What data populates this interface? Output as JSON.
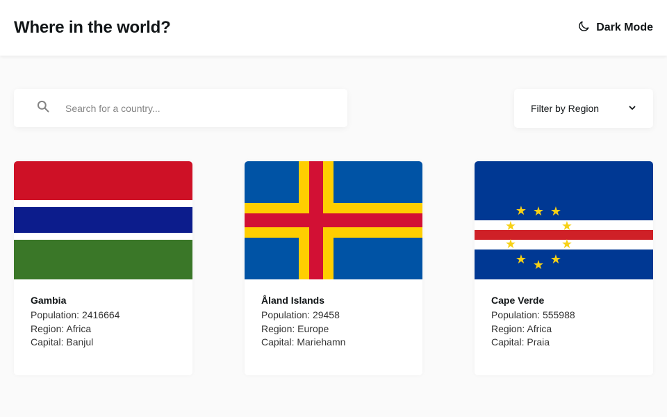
{
  "header": {
    "title": "Where in the world?",
    "theme_toggle_label": "Dark Mode",
    "theme_toggle_icon": "moon-icon"
  },
  "search": {
    "placeholder": "Search for a country...",
    "value": "",
    "icon": "search-icon"
  },
  "filter": {
    "label": "Filter by Region",
    "icon": "chevron-down-icon"
  },
  "labels": {
    "population": "Population:",
    "region": "Region:",
    "capital": "Capital:"
  },
  "countries": [
    {
      "name": "Gambia",
      "population": "2416664",
      "region": "Africa",
      "capital": "Banjul"
    },
    {
      "name": "Åland Islands",
      "population": "29458",
      "region": "Europe",
      "capital": "Mariehamn"
    },
    {
      "name": "Cape Verde",
      "population": "555988",
      "region": "Africa",
      "capital": "Praia"
    }
  ],
  "colors": {
    "background": "#fafafa",
    "card": "#ffffff",
    "text": "#111517"
  }
}
